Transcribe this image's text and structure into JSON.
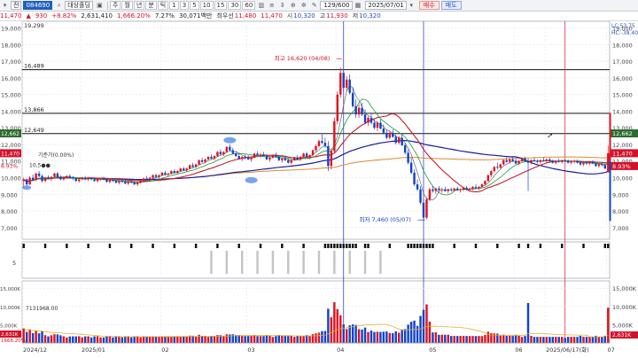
{
  "toolbar": {
    "prefix": "전",
    "code": "084690",
    "name": "대상홀딩",
    "periods": [
      "주",
      "월",
      "년",
      "분",
      "틱"
    ],
    "minutes": [
      "1",
      "3",
      "5",
      "10",
      "15",
      "30",
      "60"
    ],
    "count": "129/600",
    "date": "2025/07/01",
    "buy": "매수",
    "sell": "매도"
  },
  "quote": {
    "price": "11,470",
    "change": "930",
    "change_pct": "+8.82%",
    "volume": "2,631,410",
    "volume_pct": "1,666.20%",
    "turnover": "7.27%",
    "amount": "30,071백만",
    "best_label": "최우선",
    "best_ask": "11,480",
    "best_bid": "11,470",
    "open_label": "시",
    "open": "10,320",
    "high_label": "고",
    "high": "11,930",
    "low_label": "저",
    "low": "10,320"
  },
  "chart_data": {
    "type": "candlestick",
    "x_labels": [
      {
        "i": 0,
        "t": "2024/12"
      },
      {
        "i": 19,
        "t": "2025/01"
      },
      {
        "i": 45,
        "t": "02"
      },
      {
        "i": 73,
        "t": "03"
      },
      {
        "i": 102,
        "t": "04"
      },
      {
        "i": 132,
        "t": "05"
      },
      {
        "i": 160,
        "t": "06"
      },
      {
        "i": 170,
        "t": "2025/06/17(화)"
      },
      {
        "i": 190,
        "t": "07"
      }
    ],
    "y_ticks": [
      7000,
      8000,
      9000,
      10000,
      11000,
      12000,
      13000,
      14000,
      15000,
      16000,
      17000,
      18000,
      19000
    ],
    "y_tick_labels": [
      "7,000",
      "8,000",
      "9,000",
      "10,000",
      "11,000",
      "12,000",
      "13,000",
      "14,000",
      "15,000",
      "16,000",
      "17,000",
      "18,000",
      "19,000"
    ],
    "price_range": [
      6300,
      19400
    ],
    "levels": [
      {
        "value": 16489,
        "label": "16,489"
      },
      {
        "value": 13866,
        "label": "13,866"
      },
      {
        "value": 12649,
        "label": "12,649"
      }
    ],
    "top_left_label": "19,299",
    "top_right_labels": [
      "LC:53.75",
      "HC:-38.40"
    ],
    "right_boxes": [
      {
        "value": 12662,
        "label": "12,662",
        "color": "#2d6b2d"
      },
      {
        "value": 11470,
        "label": "11,470",
        "color": "#d4112a"
      },
      {
        "value": 10700,
        "label": "8.93%",
        "color": "#d4112a"
      }
    ],
    "left_boxes": [
      {
        "value": 12662,
        "label": "12,662",
        "color": "#2d6b2d"
      },
      {
        "value": 11470,
        "label": "11,470",
        "color": "#d4112a"
      }
    ],
    "left_pct": "8.93%",
    "annotations": {
      "high": {
        "i": 104,
        "value": 16620,
        "text": "최고 16,620 (04/08)"
      },
      "low": {
        "i": 131,
        "value": 7460,
        "text": "최저 7,460 (05/07)"
      },
      "mid": {
        "text": "10,5●●",
        "sub": "기준가(0.00%)"
      }
    },
    "vertical_markers": [
      {
        "i": 104,
        "color": "#3a3fd0"
      },
      {
        "i": 130,
        "color": "#3a3fd0"
      },
      {
        "i": 176,
        "color": "#e0304a"
      }
    ],
    "candles": [
      [
        9800,
        10000,
        9400,
        9900
      ],
      [
        9900,
        9950,
        9500,
        9600
      ],
      [
        9600,
        10100,
        9550,
        10000
      ],
      [
        10000,
        10200,
        9800,
        9850
      ],
      [
        9850,
        10300,
        9800,
        10250
      ],
      [
        10250,
        10400,
        10000,
        10100
      ],
      [
        10100,
        10200,
        9700,
        9800
      ],
      [
        9800,
        10050,
        9750,
        10000
      ],
      [
        10000,
        10150,
        9900,
        9950
      ],
      [
        9950,
        10100,
        9800,
        10050
      ],
      [
        10050,
        10300,
        9950,
        10250
      ],
      [
        10250,
        10350,
        10000,
        10050
      ],
      [
        10050,
        10150,
        9850,
        9900
      ],
      [
        9900,
        10050,
        9800,
        10000
      ],
      [
        10000,
        10150,
        9950,
        10100
      ],
      [
        10100,
        10200,
        9950,
        10000
      ],
      [
        10000,
        10100,
        9850,
        9950
      ],
      [
        9950,
        10000,
        9750,
        9800
      ],
      [
        9800,
        9950,
        9700,
        9900
      ],
      [
        9900,
        10050,
        9850,
        10000
      ],
      [
        10000,
        10100,
        9850,
        9900
      ],
      [
        9900,
        10050,
        9800,
        10000
      ],
      [
        10000,
        10050,
        9850,
        9900
      ],
      [
        9900,
        10000,
        9750,
        9800
      ],
      [
        9800,
        9950,
        9700,
        9900
      ],
      [
        9900,
        10000,
        9800,
        9950
      ],
      [
        9950,
        10050,
        9850,
        9900
      ],
      [
        9900,
        9950,
        9700,
        9750
      ],
      [
        9750,
        9900,
        9650,
        9850
      ],
      [
        9850,
        9950,
        9750,
        9800
      ],
      [
        9800,
        9900,
        9650,
        9700
      ],
      [
        9700,
        9850,
        9600,
        9800
      ],
      [
        9800,
        9900,
        9700,
        9750
      ],
      [
        9750,
        9850,
        9600,
        9650
      ],
      [
        9650,
        9800,
        9550,
        9750
      ],
      [
        9750,
        9850,
        9650,
        9700
      ],
      [
        9700,
        9800,
        9550,
        9600
      ],
      [
        9600,
        9750,
        9500,
        9700
      ],
      [
        9700,
        9850,
        9650,
        9800
      ],
      [
        9800,
        10000,
        9750,
        9950
      ],
      [
        9950,
        10100,
        9850,
        9900
      ],
      [
        9900,
        10050,
        9800,
        10000
      ],
      [
        10000,
        10200,
        9950,
        10150
      ],
      [
        10150,
        10250,
        10000,
        10050
      ],
      [
        10050,
        10200,
        9950,
        10150
      ],
      [
        10150,
        10350,
        10100,
        10300
      ],
      [
        10300,
        10400,
        10150,
        10200
      ],
      [
        10200,
        10300,
        10050,
        10250
      ],
      [
        10250,
        10450,
        10200,
        10400
      ],
      [
        10400,
        10500,
        10250,
        10300
      ],
      [
        10300,
        10450,
        10200,
        10400
      ],
      [
        10400,
        10600,
        10350,
        10550
      ],
      [
        10550,
        10650,
        10400,
        10450
      ],
      [
        10450,
        10600,
        10350,
        10550
      ],
      [
        10550,
        10800,
        10500,
        10750
      ],
      [
        10750,
        10900,
        10600,
        10650
      ],
      [
        10650,
        10850,
        10600,
        10800
      ],
      [
        10800,
        11100,
        10750,
        11050
      ],
      [
        11050,
        11200,
        10900,
        10950
      ],
      [
        10950,
        11150,
        10850,
        11100
      ],
      [
        11100,
        11300,
        11050,
        11250
      ],
      [
        11250,
        11400,
        11100,
        11150
      ],
      [
        11150,
        11350,
        11050,
        11300
      ],
      [
        11300,
        11600,
        11250,
        11550
      ],
      [
        11550,
        11700,
        11350,
        11400
      ],
      [
        11400,
        11600,
        11300,
        11550
      ],
      [
        11550,
        11900,
        11500,
        11850
      ],
      [
        11850,
        12000,
        11600,
        11650
      ],
      [
        11650,
        11800,
        11400,
        11450
      ],
      [
        11450,
        11600,
        11250,
        11300
      ],
      [
        11300,
        11450,
        11100,
        11150
      ],
      [
        11150,
        11300,
        11000,
        11250
      ],
      [
        11250,
        11400,
        11100,
        11200
      ],
      [
        11200,
        11350,
        11050,
        11100
      ],
      [
        11100,
        11250,
        10950,
        11200
      ],
      [
        11200,
        11500,
        11150,
        11450
      ],
      [
        11450,
        11600,
        11300,
        11350
      ],
      [
        11350,
        11500,
        11200,
        11400
      ],
      [
        11400,
        11550,
        11250,
        11300
      ],
      [
        11300,
        11400,
        11050,
        11100
      ],
      [
        11100,
        11250,
        10950,
        11200
      ],
      [
        11200,
        11400,
        11150,
        11350
      ],
      [
        11350,
        11500,
        11200,
        11250
      ],
      [
        11250,
        11350,
        11000,
        11050
      ],
      [
        11050,
        11200,
        10900,
        11150
      ],
      [
        11150,
        11300,
        11000,
        11050
      ],
      [
        11050,
        11150,
        10850,
        10900
      ],
      [
        10900,
        11100,
        10800,
        11050
      ],
      [
        11050,
        11250,
        11000,
        11200
      ],
      [
        11200,
        11350,
        11050,
        11100
      ],
      [
        11100,
        11300,
        11000,
        11250
      ],
      [
        11250,
        11500,
        11200,
        11450
      ],
      [
        11450,
        11550,
        11200,
        11250
      ],
      [
        11250,
        11400,
        11100,
        11350
      ],
      [
        11350,
        11700,
        11300,
        11650
      ],
      [
        11650,
        12000,
        11550,
        11900
      ],
      [
        11900,
        12300,
        11800,
        12200
      ],
      [
        12200,
        12600,
        12000,
        12100
      ],
      [
        12100,
        12400,
        11800,
        11900
      ],
      [
        11900,
        12200,
        10400,
        10700
      ],
      [
        10700,
        11700,
        10500,
        11600
      ],
      [
        11600,
        13600,
        11500,
        13400
      ],
      [
        13400,
        15200,
        13200,
        15000
      ],
      [
        15000,
        16620,
        14800,
        16300
      ],
      [
        16300,
        16500,
        15200,
        15400
      ],
      [
        15400,
        16100,
        15200,
        15900
      ],
      [
        15900,
        16200,
        15000,
        15100
      ],
      [
        15100,
        15400,
        14200,
        14300
      ],
      [
        14300,
        14700,
        13600,
        13800
      ],
      [
        13800,
        14400,
        13600,
        14200
      ],
      [
        14200,
        14500,
        13700,
        13800
      ],
      [
        13800,
        14100,
        13200,
        13300
      ],
      [
        13300,
        13700,
        13100,
        13600
      ],
      [
        13600,
        13900,
        13200,
        13300
      ],
      [
        13300,
        13500,
        12900,
        13000
      ],
      [
        13000,
        13400,
        12800,
        13300
      ],
      [
        13300,
        13500,
        12900,
        12950
      ],
      [
        12950,
        13200,
        12600,
        12700
      ],
      [
        12700,
        12900,
        12300,
        12400
      ],
      [
        12400,
        12800,
        12300,
        12700
      ],
      [
        12700,
        12900,
        12400,
        12450
      ],
      [
        12450,
        12600,
        12000,
        12100
      ],
      [
        12100,
        12500,
        12000,
        12400
      ],
      [
        12400,
        12600,
        11900,
        11950
      ],
      [
        11950,
        12100,
        11400,
        11500
      ],
      [
        11500,
        11700,
        10800,
        10900
      ],
      [
        10900,
        11200,
        10200,
        10300
      ],
      [
        10300,
        10500,
        9500,
        9600
      ],
      [
        9600,
        9900,
        9200,
        9300
      ],
      [
        9300,
        9500,
        8400,
        8500
      ],
      [
        8500,
        8700,
        7460,
        7600
      ],
      [
        7600,
        8800,
        7500,
        8700
      ],
      [
        8700,
        9400,
        8600,
        9300
      ],
      [
        9300,
        9500,
        9100,
        9200
      ],
      [
        9200,
        9400,
        9000,
        9350
      ],
      [
        9350,
        9500,
        9200,
        9250
      ],
      [
        9250,
        9400,
        9100,
        9300
      ],
      [
        9300,
        9450,
        9150,
        9200
      ],
      [
        9200,
        9350,
        9050,
        9300
      ],
      [
        9300,
        9400,
        9150,
        9250
      ],
      [
        9250,
        9400,
        9150,
        9350
      ],
      [
        9350,
        9450,
        9200,
        9250
      ],
      [
        9250,
        9350,
        9100,
        9300
      ],
      [
        9300,
        9450,
        9200,
        9400
      ],
      [
        9400,
        9500,
        9250,
        9300
      ],
      [
        9300,
        9400,
        9150,
        9350
      ],
      [
        9350,
        9500,
        9250,
        9450
      ],
      [
        9450,
        9600,
        9350,
        9400
      ],
      [
        9400,
        9500,
        9250,
        9450
      ],
      [
        9450,
        9650,
        9400,
        9600
      ],
      [
        9600,
        9850,
        9550,
        9800
      ],
      [
        9800,
        10200,
        9750,
        10150
      ],
      [
        10150,
        10450,
        10050,
        10400
      ],
      [
        10400,
        10700,
        10300,
        10650
      ],
      [
        10650,
        10900,
        10500,
        10600
      ],
      [
        10600,
        10850,
        10550,
        10800
      ],
      [
        10800,
        11100,
        10750,
        11050
      ],
      [
        11050,
        11200,
        10900,
        10950
      ],
      [
        10950,
        11150,
        10850,
        11100
      ],
      [
        11100,
        11250,
        10950,
        11000
      ],
      [
        11000,
        11150,
        10800,
        10850
      ],
      [
        10850,
        11050,
        10750,
        11000
      ],
      [
        11000,
        11200,
        10950,
        11150
      ],
      [
        11150,
        11250,
        10950,
        11000
      ],
      [
        11000,
        11150,
        9200,
        10900
      ],
      [
        10900,
        11100,
        10800,
        11050
      ],
      [
        11050,
        11200,
        10950,
        11000
      ],
      [
        11000,
        11100,
        10850,
        10950
      ],
      [
        10950,
        11100,
        10850,
        11050
      ],
      [
        11050,
        11200,
        10950,
        11000
      ],
      [
        11000,
        11150,
        10900,
        11100
      ],
      [
        11100,
        11200,
        10950,
        11000
      ],
      [
        11000,
        11100,
        10850,
        10900
      ],
      [
        10900,
        11050,
        10800,
        11000
      ],
      [
        11000,
        11150,
        10900,
        10950
      ],
      [
        10950,
        11100,
        10850,
        11050
      ],
      [
        11050,
        11150,
        10950,
        11000
      ],
      [
        11000,
        11100,
        10850,
        10900
      ],
      [
        10900,
        11050,
        10800,
        10950
      ],
      [
        10950,
        11100,
        10850,
        11000
      ],
      [
        11000,
        11100,
        10850,
        10900
      ],
      [
        10900,
        11000,
        10700,
        10800
      ],
      [
        10800,
        10950,
        10700,
        10900
      ],
      [
        10900,
        11000,
        10750,
        10850
      ],
      [
        10850,
        11000,
        10750,
        10950
      ],
      [
        10950,
        11050,
        10800,
        10850
      ],
      [
        10850,
        10950,
        10650,
        10700
      ],
      [
        10700,
        10850,
        10600,
        10800
      ],
      [
        10800,
        10950,
        10700,
        10750
      ],
      [
        10750,
        10850,
        10550,
        10540
      ],
      [
        10320,
        11930,
        10320,
        11470
      ]
    ],
    "mid_panel": {
      "label": "5"
    },
    "volume_panel": {
      "y_ticks": [
        5000,
        10000,
        15000
      ],
      "y_tick_labels": [
        "5,000K",
        "10,000K",
        "15,000K"
      ],
      "range": [
        0,
        17000
      ],
      "left_ticks": [
        "15,000K",
        "10,000K",
        "5,000K"
      ],
      "avg_label": "7131968.00",
      "last_label": "2,631K",
      "last_pct": "1666.20%"
    }
  }
}
